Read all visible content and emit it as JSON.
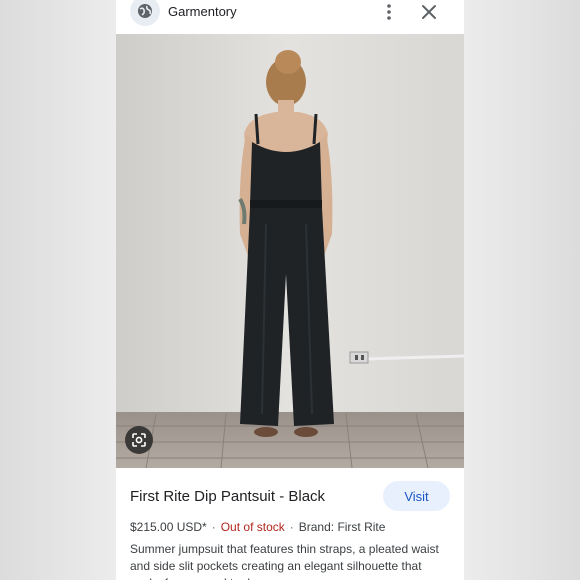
{
  "header": {
    "site_name": "Garmentory",
    "site_icon": "globe-icon",
    "more_icon": "more-vert-icon",
    "close_icon": "close-icon"
  },
  "image": {
    "alt": "Woman in black pantsuit viewed from behind",
    "lens_icon": "google-lens-icon"
  },
  "product": {
    "title": "First Rite Dip Pantsuit - Black",
    "visit_label": "Visit",
    "price": "$215.00 USD*",
    "separator": "·",
    "stock": "Out of stock",
    "brand": "Brand: First Rite",
    "description": "Summer jumpsuit that features thin straps, a pleated waist and side slit pockets creating an elegant silhouette that works from casual to dressy"
  },
  "colors": {
    "accent": "#1a57c5",
    "visit_bg": "#e8f0fe",
    "stock": "#b3261e",
    "garment": "#1f2326"
  }
}
